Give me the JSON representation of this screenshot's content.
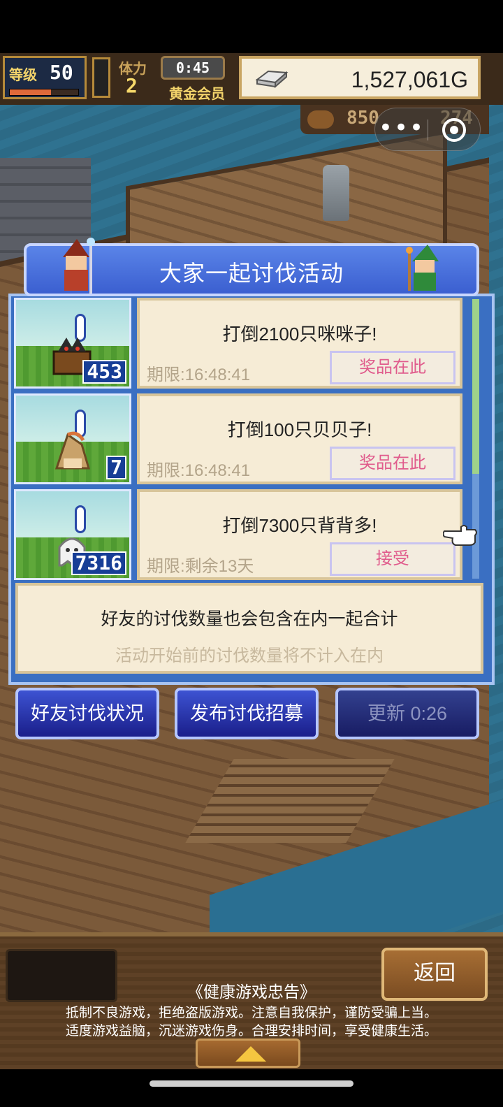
{
  "hud": {
    "level_label": "等级",
    "level_value": "50",
    "level_progress": 0.6,
    "stamina_label": "体力",
    "stamina_value": "2",
    "timer": "0:45",
    "membership": "黄金会员",
    "gold": "1,527,061G",
    "resource_a": "850",
    "resource_b": "274"
  },
  "capsule": {
    "more_icon": "more-dots-icon",
    "close_icon": "target-close-icon",
    "more_glyph": "•••"
  },
  "panel": {
    "title": "大家一起讨伐活动"
  },
  "quests": [
    {
      "name": "打倒2100只咪咪子!",
      "count": "453",
      "deadline": "期限:16:48:41",
      "action": "奖品在此"
    },
    {
      "name": "打倒100只贝贝子!",
      "count": "7",
      "deadline": "期限:16:48:41",
      "action": "奖品在此"
    },
    {
      "name": "打倒7300只背背多!",
      "count": "7316",
      "deadline": "期限:剩余13天",
      "action": "接受"
    }
  ],
  "notice": {
    "main": "好友的讨伐数量也会包含在内一起合计",
    "sub": "活动开始前的讨伐数量将不计入在内"
  },
  "buttons": {
    "friends_status": "好友讨伐状况",
    "post_recruit": "发布讨伐招募",
    "refresh": "更新 0:26"
  },
  "footer": {
    "back": "返回",
    "advisory_title": "《健康游戏忠告》",
    "advisory_line1": "抵制不良游戏，拒绝盗版游戏。注意自我保护，谨防受骗上当。",
    "advisory_line2": "适度游戏益脑，沉迷游戏伤身。合理安排时间，享受健康生活。"
  },
  "colors": {
    "panel_blue": "#3a6fc2",
    "card_bg": "#f6ecd6",
    "action_pink": "#e05b8c",
    "gold_text": "#f3d46b"
  }
}
